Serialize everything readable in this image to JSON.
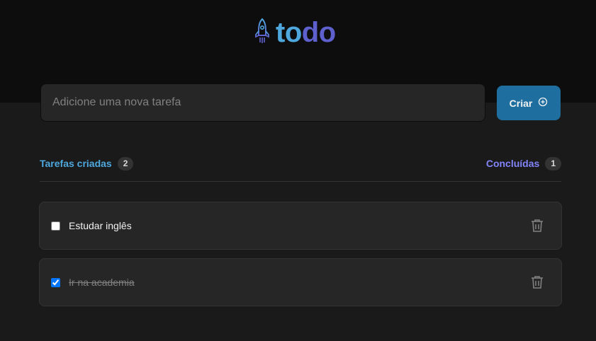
{
  "header": {
    "logo_part1": "to",
    "logo_part2": "do"
  },
  "new_task": {
    "placeholder": "Adicione uma nova tarefa",
    "value": ""
  },
  "create_button": {
    "label": "Criar"
  },
  "counters": {
    "created_label": "Tarefas criadas",
    "created_count": "2",
    "done_label": "Concluídas",
    "done_count": "1"
  },
  "tasks": [
    {
      "text": "Estudar inglês",
      "completed": false
    },
    {
      "text": "Ir na academia",
      "completed": true
    }
  ],
  "colors": {
    "blue": "#4ea8de",
    "purple": "#5e60ce",
    "button": "#1e6f9f",
    "background": "#1a1a1a",
    "header_bg": "#0d0d0d"
  },
  "icons": {
    "logo": "rocket-icon",
    "create": "plus-circle-icon",
    "delete": "trash-icon"
  }
}
